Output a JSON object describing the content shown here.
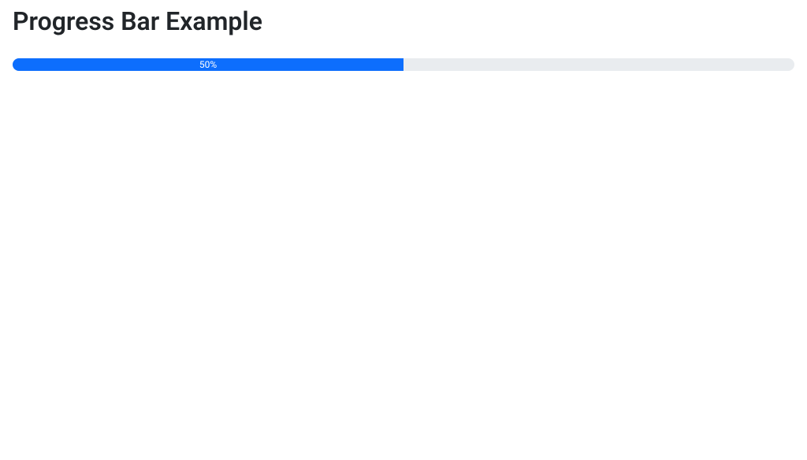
{
  "heading": "Progress Bar Example",
  "progress": {
    "percent": 50,
    "label": "50%",
    "bar_color": "#0d6efd",
    "track_color": "#e9ecef"
  }
}
